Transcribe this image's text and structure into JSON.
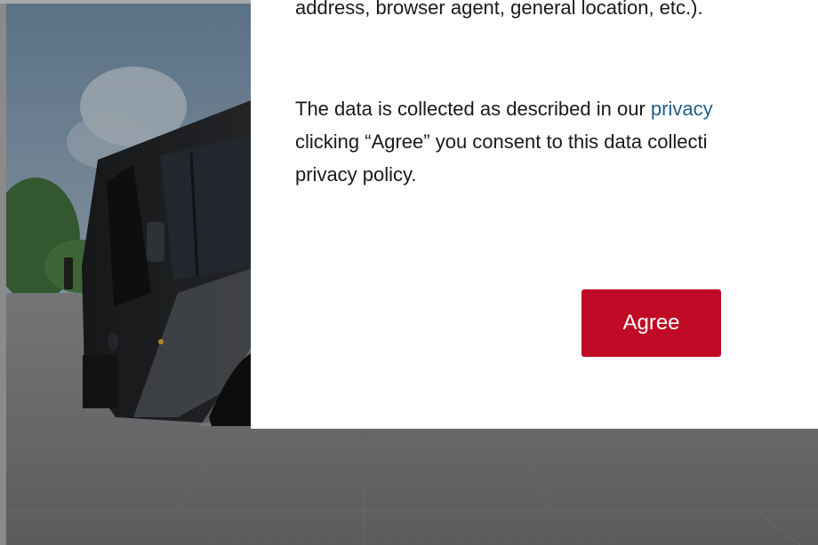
{
  "hero": {
    "image": "rv-motorcoach-photo"
  },
  "consent_modal": {
    "paragraph1": "address, browser agent, general location, etc.).",
    "paragraph2": {
      "line1_pre": "The data is collected as described in our ",
      "link_text": "privacy",
      "line2": "clicking “Agree” you consent to this data collecti",
      "line3": "privacy policy."
    },
    "agree_label": "Agree"
  },
  "colors": {
    "button_bg": "#c10a25",
    "link": "#1f5f8b",
    "text": "#1a1a1a"
  }
}
